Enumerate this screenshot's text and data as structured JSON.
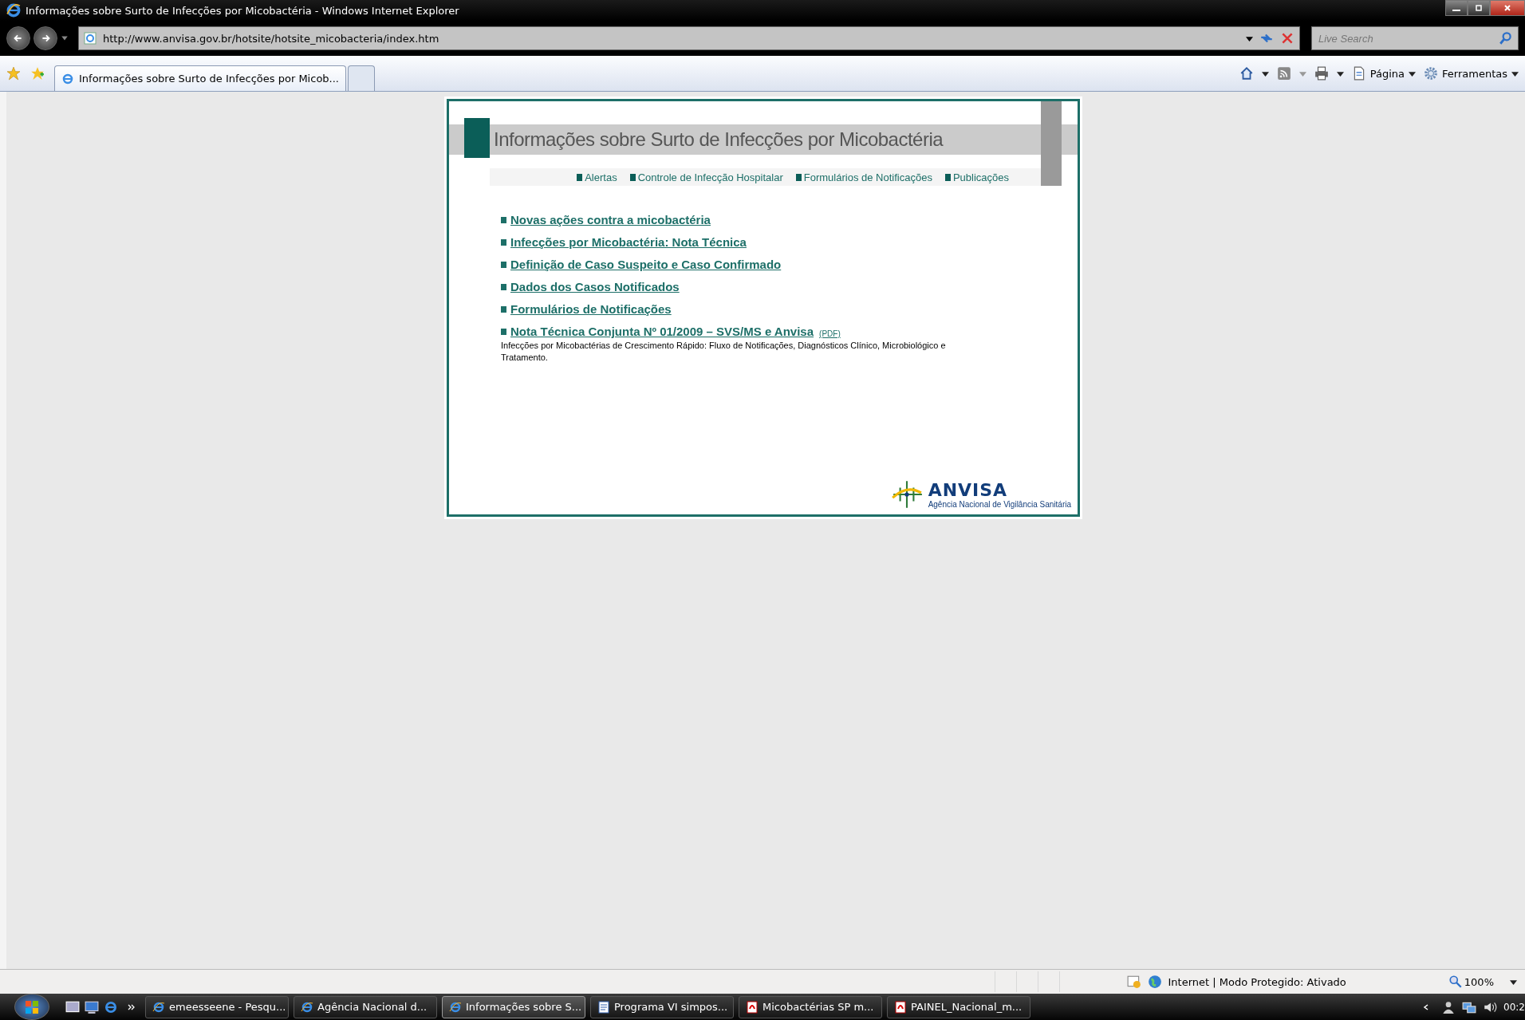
{
  "window": {
    "title": "Informações sobre Surto de Infecções por Micobactéria - Windows Internet Explorer"
  },
  "address_bar": {
    "url": "http://www.anvisa.gov.br/hotsite/hotsite_micobacteria/index.htm"
  },
  "search": {
    "placeholder": "Live Search"
  },
  "tabs": [
    {
      "label": "Informações sobre Surto de Infecções por Micob...",
      "selected": true
    }
  ],
  "command_bar": {
    "page_menu": "Página",
    "tools_menu": "Ferramentas"
  },
  "page": {
    "title": "Informações sobre Surto de Infecções por Micobactéria",
    "nav": [
      "Alertas",
      "Controle de Infecção Hospitalar",
      "Formulários de Notificações",
      "Publicações"
    ],
    "links": [
      {
        "label": "Novas ações contra a micobactéria"
      },
      {
        "label": "Infecções por Micobactéria: Nota Técnica"
      },
      {
        "label": "Definição de Caso Suspeito e Caso Confirmado"
      },
      {
        "label": "Dados dos Casos Notificados"
      },
      {
        "label": "Formulários de Notificações"
      },
      {
        "label": "Nota Técnica Conjunta Nº 01/2009 – SVS/MS e Anvisa",
        "file": "(PDF)",
        "description": "Infecções por Micobactérias de Crescimento Rápido: Fluxo de Notificações, Diagnósticos Clínico, Microbiológico e Tratamento."
      }
    ],
    "logo": {
      "name": "ANVISA",
      "subtitle": "Agência Nacional de Vigilância Sanitária"
    }
  },
  "status_bar": {
    "zone": "Internet | Modo Protegido: Ativado",
    "zoom": "100%"
  },
  "taskbar": {
    "items": [
      {
        "label": "emeesseene - Pesqu...",
        "kind": "browser",
        "selected": false
      },
      {
        "label": "Agência Nacional d...",
        "kind": "browser",
        "selected": false
      },
      {
        "label": "Informações sobre S...",
        "kind": "browser",
        "selected": true
      },
      {
        "label": "Programa VI simpos...",
        "kind": "document",
        "selected": false
      },
      {
        "label": "Micobactérias SP m...",
        "kind": "pdf",
        "selected": false
      },
      {
        "label": "PAINEL_Nacional_m...",
        "kind": "pdf",
        "selected": false
      }
    ],
    "clock": "00:2"
  }
}
